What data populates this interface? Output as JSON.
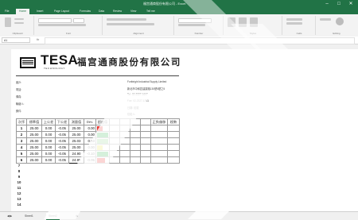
{
  "window": {
    "title": "福宫通商股份有限公司 - Excel",
    "accent": "#217346",
    "minimize_glyph": "–",
    "maximize_glyph": "□",
    "close_glyph": "✕"
  },
  "ribbon_tabs": [
    "File",
    "Home",
    "Insert",
    "Page Layout",
    "Formulas",
    "Data",
    "Review",
    "View",
    "Tell me"
  ],
  "ribbon_groups": [
    "Clipboard",
    "Font",
    "Alignment",
    "Number",
    "Styles",
    "Cells",
    "Editing"
  ],
  "formula_bar": {
    "name_box": "A1",
    "fx": "fx"
  },
  "document": {
    "logo_text": "TESA",
    "logo_subtext": "TECHNOLOGY",
    "company_name": "福宫通商股份有限公司",
    "left_labels": [
      "客戶:",
      "電話:",
      "傳真:",
      "聯絡人:",
      "郵件:"
    ],
    "right_info": [
      "Fortbright Industrial Supply Limited",
      "新北市中和區建康路130號5樓之5",
      "Tel: 02-2227-1607",
      "Fax: 02-2227-1391",
      "日期: 檢驗",
      "檢驗人:"
    ]
  },
  "table": {
    "headers": [
      "次序",
      "標準值",
      "上公差",
      "下公差",
      "測量值",
      "Dev.",
      "超出值",
      "",
      "",
      "",
      "",
      "正負偏移",
      "趨勢"
    ],
    "rows": [
      {
        "n": "1",
        "std": "25.00",
        "up": "0.00",
        "low": "-0.05",
        "meas": "25.00",
        "dev": "0.00"
      },
      {
        "n": "2",
        "std": "25.00",
        "up": "0.00",
        "low": "-0.05",
        "meas": "25.00",
        "dev": "0.00"
      },
      {
        "n": "3",
        "std": "25.00",
        "up": "0.00",
        "low": "-0.05",
        "meas": "25.03",
        "dev": "0.03"
      },
      {
        "n": "4",
        "std": "25.00",
        "up": "0.00",
        "low": "-0.05",
        "meas": "25.00",
        "dev": "0.00"
      },
      {
        "n": "5",
        "std": "25.00",
        "up": "0.00",
        "low": "-0.05",
        "meas": "24.90",
        "dev": "-0.10"
      },
      {
        "n": "6",
        "std": "25.00",
        "up": "0.00",
        "low": "-0.05",
        "meas": "24.95",
        "dev": "-0.05"
      }
    ],
    "bar_colors": {
      "red": "#e8302a",
      "green": "#2db34a",
      "lightgreen": "#8fd08a",
      "yellow": "#e8e04a"
    },
    "empty_rows": [
      "7",
      "8",
      "9",
      "10",
      "11",
      "12",
      "13",
      "14"
    ]
  },
  "sheet_tabs": [
    "Sheet1",
    "Sheet2"
  ]
}
